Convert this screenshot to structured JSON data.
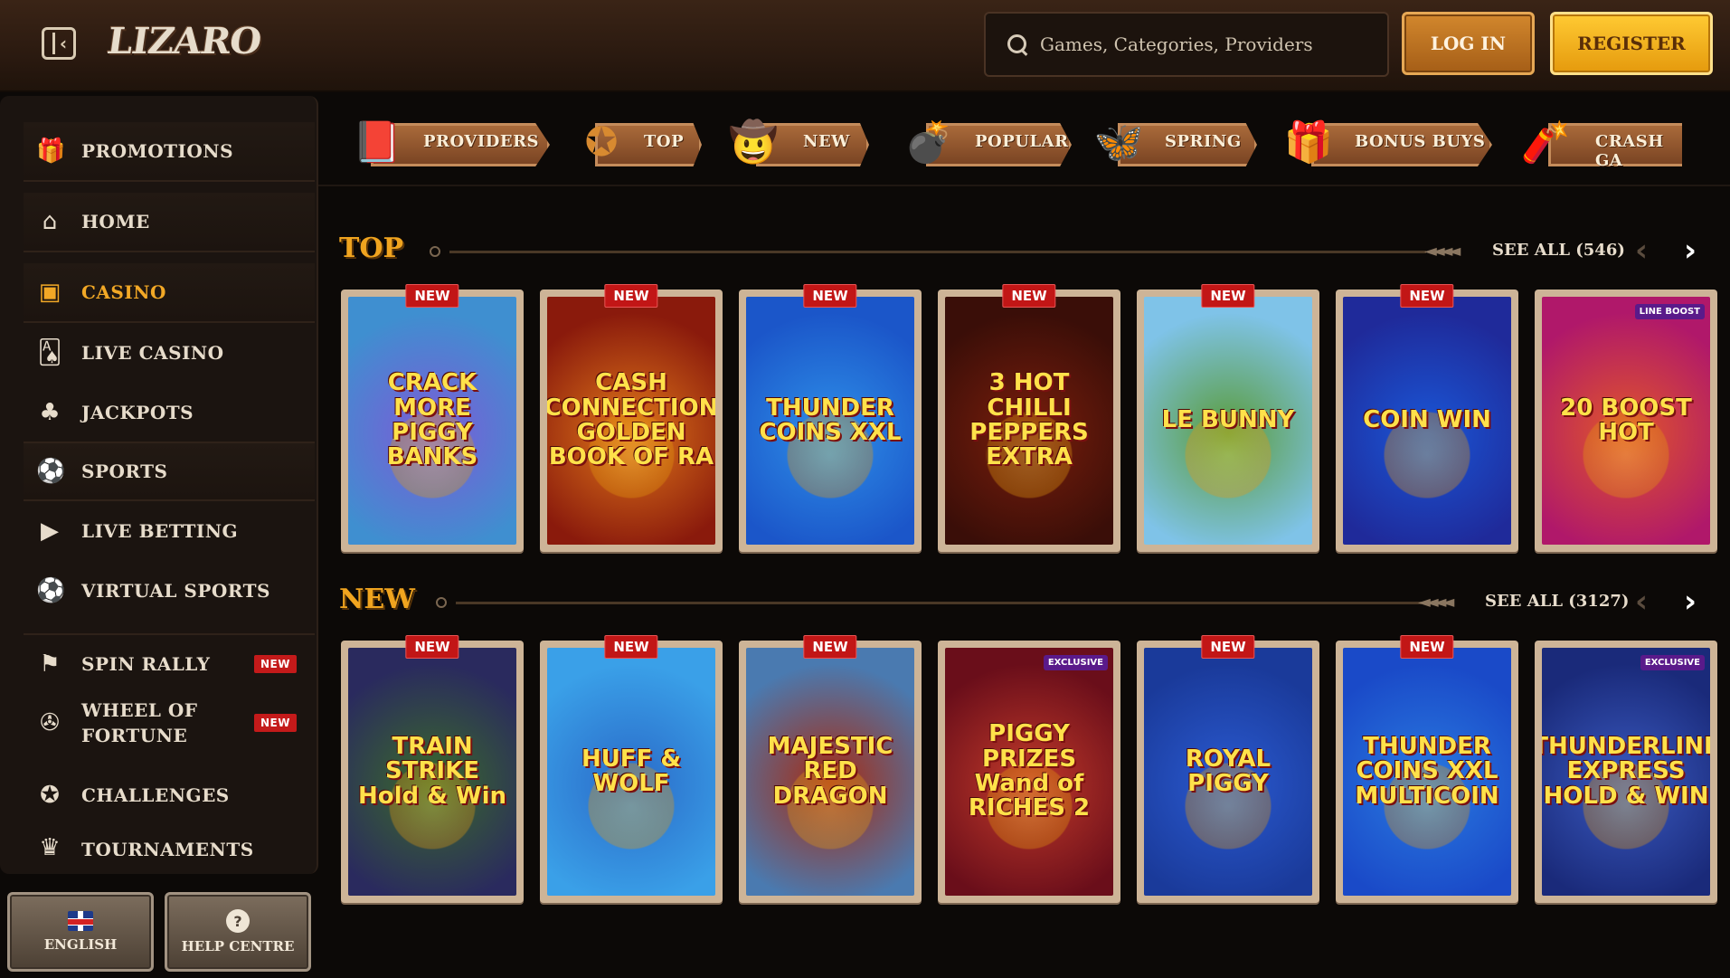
{
  "header": {
    "logo_text": "LIZARO",
    "search_placeholder": "Games, Categories, Providers",
    "login_label": "LOG IN",
    "register_label": "REGISTER"
  },
  "sidebar": {
    "items": [
      {
        "label": "PROMOTIONS",
        "icon": "gift-icon"
      },
      {
        "label": "HOME",
        "icon": "home-icon"
      },
      {
        "label": "CASINO",
        "icon": "casino-icon",
        "active": true
      },
      {
        "label": "LIVE CASINO",
        "icon": "live-casino-icon"
      },
      {
        "label": "JACKPOTS",
        "icon": "clover-icon"
      },
      {
        "label": "SPORTS",
        "icon": "soccer-ball-icon"
      },
      {
        "label": "LIVE BETTING",
        "icon": "play-icon"
      },
      {
        "label": "VIRTUAL SPORTS",
        "icon": "virtual-sports-icon"
      },
      {
        "label": "SPIN RALLY",
        "icon": "rally-icon",
        "badge": "NEW"
      },
      {
        "label": "WHEEL OF FORTUNE",
        "label_line1": "WHEEL OF",
        "label_line2": "FORTUNE",
        "icon": "wheel-icon",
        "badge": "NEW"
      },
      {
        "label": "CHALLENGES",
        "icon": "challenge-icon"
      },
      {
        "label": "TOURNAMENTS",
        "icon": "tournament-icon"
      }
    ],
    "language_label": "ENGLISH",
    "help_label": "HELP CENTRE"
  },
  "categories": [
    {
      "label": "PROVIDERS",
      "icon": "book-icon"
    },
    {
      "label": "TOP",
      "icon": "sheriff-star-icon"
    },
    {
      "label": "NEW",
      "icon": "cowboy-hat-icon"
    },
    {
      "label": "POPULAR",
      "icon": "bomb-icon"
    },
    {
      "label": "SPRING",
      "icon": "butterfly-icon"
    },
    {
      "label": "BONUS BUYS",
      "icon": "gift-box-icon"
    },
    {
      "label": "CRASH GA",
      "icon": "dynamite-icon"
    }
  ],
  "sections": [
    {
      "title": "TOP",
      "see_all": "SEE ALL (546)",
      "games": [
        {
          "title": "CRACK MORE PIGGY BANKS",
          "badge": "NEW",
          "bg": "#3f8fd0",
          "bg2": "#7c5bd6"
        },
        {
          "title": "CASH CONNECTION GOLDEN BOOK OF RA",
          "badge": "NEW",
          "bg": "#8a1a0c",
          "bg2": "#e0781a"
        },
        {
          "title": "THUNDER COINS XXL",
          "badge": "NEW",
          "bg": "#1b56c9",
          "bg2": "#2e8fe8"
        },
        {
          "title": "3 HOT CHILLI PEPPERS EXTRA",
          "badge": "NEW",
          "bg": "#3a0e08",
          "bg2": "#7a1e0c"
        },
        {
          "title": "LE BUNNY",
          "badge": "NEW",
          "bg": "#7fc3e8",
          "bg2": "#5a9c3a"
        },
        {
          "title": "COIN WIN",
          "badge": "NEW",
          "bg": "#1f2a9a",
          "bg2": "#1a56d6"
        },
        {
          "title": "20 BOOST HOT",
          "badge": "",
          "extra": "LINE BOOST",
          "bg": "#b0186a",
          "bg2": "#e0562a"
        }
      ]
    },
    {
      "title": "NEW",
      "see_all": "SEE ALL (3127)",
      "games": [
        {
          "title": "TRAIN STRIKE Hold & Win",
          "badge": "NEW",
          "bg": "#2a2a5e",
          "bg2": "#3a6a2a"
        },
        {
          "title": "HUFF & WOLF",
          "badge": "NEW",
          "bg": "#3aa0e8",
          "bg2": "#2a6ac8"
        },
        {
          "title": "MAJESTIC RED DRAGON",
          "badge": "NEW",
          "bg": "#4a7ab0",
          "bg2": "#a82a10"
        },
        {
          "title": "PIGGY PRIZES Wand of RICHES 2",
          "badge": "",
          "extra": "EXCLUSIVE",
          "bg": "#6a0e1a",
          "bg2": "#c23a2a"
        },
        {
          "title": "ROYAL PIGGY",
          "badge": "NEW",
          "bg": "#1a3a9a",
          "bg2": "#2a5ad0"
        },
        {
          "title": "THUNDER COINS XXL MULTICOIN",
          "badge": "NEW",
          "bg": "#1a4ac8",
          "bg2": "#2a7ae0"
        },
        {
          "title": "THUNDERLINE EXPRESS HOLD & WIN",
          "badge": "",
          "extra": "EXCLUSIVE",
          "bg": "#1a2a7a",
          "bg2": "#3a5ac0"
        }
      ]
    }
  ],
  "colors": {
    "accent": "#f0a41f",
    "badge_red": "#c21616",
    "login_orange": "#c27423",
    "register_yellow": "#f6b41f"
  }
}
